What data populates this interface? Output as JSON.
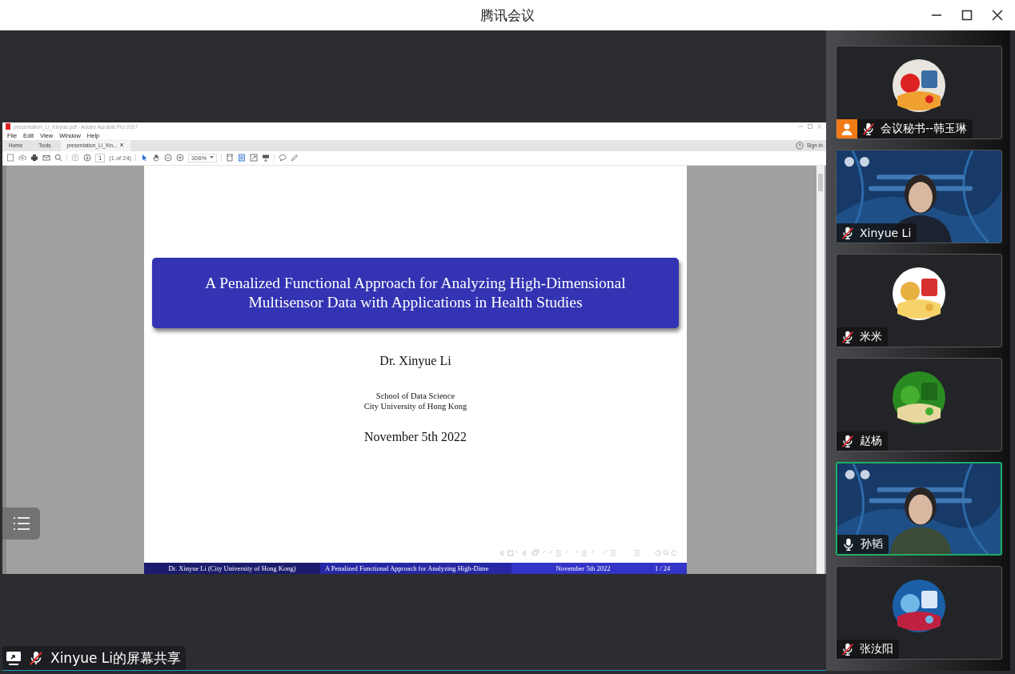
{
  "window": {
    "title": "腾讯会议"
  },
  "share": {
    "sharer_label": "Xinyue Li的屏幕共享",
    "sharer_muted": true,
    "acrobat": {
      "title": "presentation_Li_Xinyue.pdf - Adobe Acrobat Pro 2017",
      "menu": [
        "File",
        "Edit",
        "View",
        "Window",
        "Help"
      ],
      "tabs": [
        {
          "label": "Home",
          "selected": false
        },
        {
          "label": "Tools",
          "selected": false
        },
        {
          "label": "presentation_Li_Xin...",
          "selected": true
        }
      ],
      "page_number": "1",
      "page_count": "(1 of 24)",
      "zoom": "306%",
      "sign_in": "Sign In"
    },
    "slide": {
      "title": "A Penalized Functional Approach for Analyzing High-Dimensional Multisensor Data with Applications in Health Studies",
      "author": "Dr. Xinyue Li",
      "affiliation": [
        "School of Data Science",
        "City University of Hong Kong"
      ],
      "date": "November 5th 2022",
      "footer": [
        "Dr. Xinyue Li  (City University of Hong Kong)",
        "A Penalized Functional Approach for Analyzing High-Dime",
        "November 5th 2022",
        "1 / 24"
      ]
    }
  },
  "participants": [
    {
      "name": "会议秘书--韩玉琳",
      "kind": "avatar",
      "host": true,
      "muted": true,
      "speaking": false
    },
    {
      "name": "Xinyue Li",
      "kind": "video",
      "host": false,
      "muted": true,
      "speaking": false
    },
    {
      "name": "米米",
      "kind": "avatar",
      "host": false,
      "muted": true,
      "speaking": false
    },
    {
      "name": "赵杨",
      "kind": "avatar",
      "host": false,
      "muted": true,
      "speaking": false
    },
    {
      "name": "孙韬",
      "kind": "video",
      "host": false,
      "muted": false,
      "speaking": true
    },
    {
      "name": "张汝阳",
      "kind": "avatar",
      "host": false,
      "muted": true,
      "speaking": false
    }
  ]
}
